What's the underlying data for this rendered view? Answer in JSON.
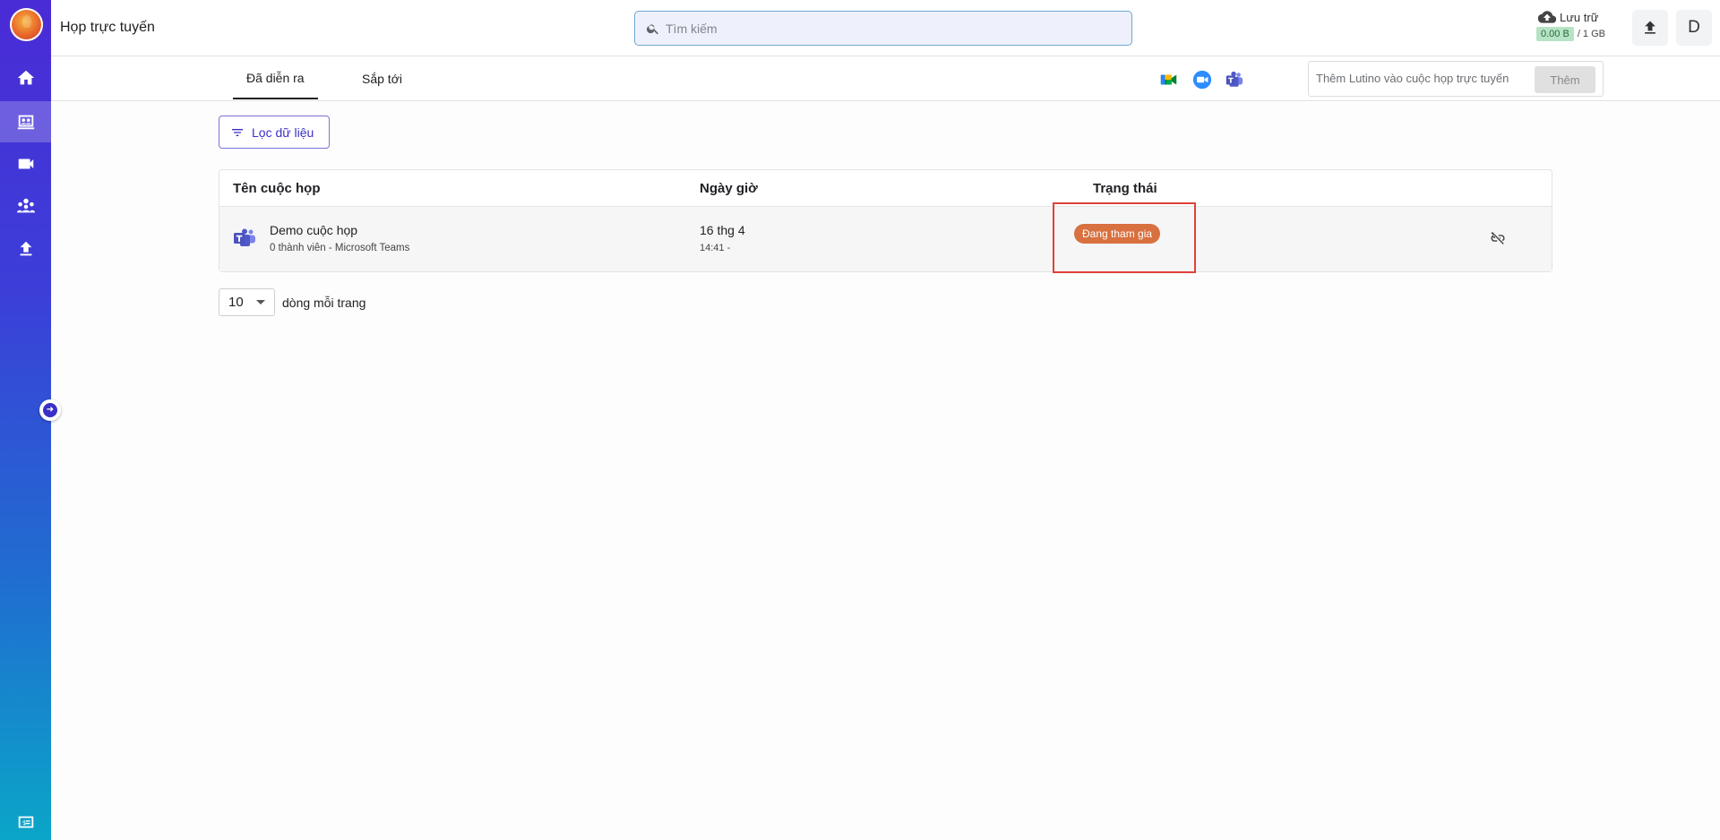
{
  "app": {
    "title": "Họp trực tuyến"
  },
  "search": {
    "placeholder": "Tìm kiếm"
  },
  "storage": {
    "label": "Lưu trữ",
    "used": "0.00 B",
    "total": "/ 1 GB"
  },
  "header": {
    "avatar_letter": "D"
  },
  "sidebar": {
    "items": [
      {
        "icon": "home-icon"
      },
      {
        "icon": "meeting-room-icon",
        "active": true
      },
      {
        "icon": "video-camera-icon"
      },
      {
        "icon": "group-icon"
      },
      {
        "icon": "upload-icon"
      },
      {
        "icon": "id-card-icon"
      }
    ]
  },
  "tabs": [
    {
      "label": "Đã diễn ra",
      "active": true
    },
    {
      "label": "Sắp tới"
    }
  ],
  "providers": [
    "google-meet-icon",
    "zoom-icon",
    "teams-icon"
  ],
  "add_bot": {
    "placeholder": "Thêm Lutino vào cuộc họp trực tuyến",
    "button": "Thêm"
  },
  "filter": {
    "label": "Lọc dữ liệu"
  },
  "table": {
    "columns": [
      "Tên cuộc họp",
      "Ngày giờ",
      "Trạng thái"
    ],
    "rows": [
      {
        "name": "Demo cuộc họp",
        "subtitle": "0 thành viên - Microsoft Teams",
        "date": "16 thg 4",
        "time": "14:41 -",
        "status": "Đang tham gia"
      }
    ]
  },
  "pagination": {
    "page_size": "10",
    "label": "dòng mỗi trang"
  },
  "colors": {
    "accent": "#3a2fc9",
    "status": "#d8703f",
    "highlight": "#e0413a"
  }
}
